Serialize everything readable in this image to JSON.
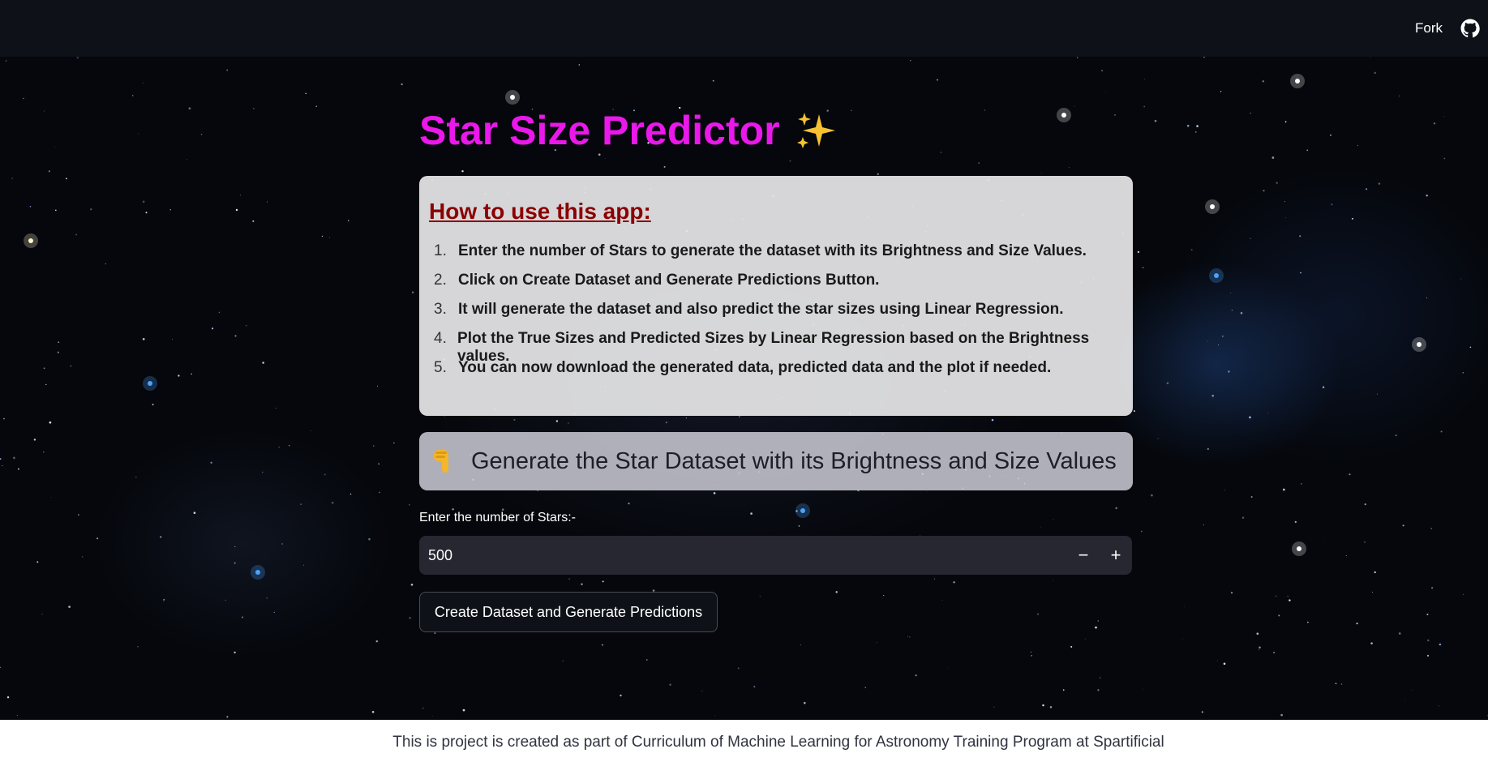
{
  "header": {
    "fork_label": "Fork",
    "github_icon": "github-icon"
  },
  "app": {
    "title": "Star Size Predictor",
    "title_icon": "sparkles-icon",
    "title_color": "#ea18ea"
  },
  "howto": {
    "title": "How to use this app:",
    "title_color": "#8b0000",
    "steps": [
      {
        "num": "1.",
        "text": "Enter the number of Stars to generate the dataset with its Brightness and Size Values."
      },
      {
        "num": "2.",
        "text": "Click on Create Dataset and Generate Predictions Button."
      },
      {
        "num": "3.",
        "text": "It will generate the dataset and also predict the star sizes using Linear Regression."
      },
      {
        "num": "4.",
        "text": "Plot the True Sizes and Predicted Sizes by Linear Regression based on the Brightness values."
      },
      {
        "num": "5.",
        "text": "You can now download the generated data, predicted data and the plot if needed."
      }
    ]
  },
  "generate": {
    "icon": "pointing-down-hand-icon",
    "heading": "Generate the Star Dataset with its Brightness and Size Values"
  },
  "stars_input": {
    "label": "Enter the number of Stars:-",
    "value": "500",
    "decrement_label": "−",
    "increment_label": "+"
  },
  "create_button": {
    "label": "Create Dataset and Generate Predictions"
  },
  "footer": {
    "text": "This is project is created as part of Curriculum of Machine Learning for Astronomy Training Program at Spartificial"
  }
}
